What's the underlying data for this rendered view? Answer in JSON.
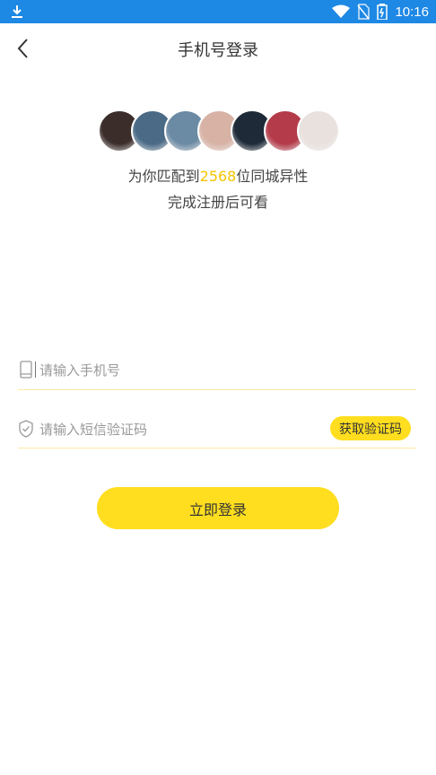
{
  "status_bar": {
    "time": "10:16"
  },
  "header": {
    "title": "手机号登录"
  },
  "match": {
    "prefix": "为你匹配到",
    "count": "2568",
    "suffix": "位同城异性",
    "subtitle": "完成注册后可看"
  },
  "avatars": [
    {
      "color": "#3a2d2a"
    },
    {
      "color": "#4a6a85"
    },
    {
      "color": "#6b8aa3"
    },
    {
      "color": "#d7b2a5"
    },
    {
      "color": "#1e2a38"
    },
    {
      "color": "#b43b4a"
    },
    {
      "color": "#e9e1de"
    }
  ],
  "form": {
    "phone_placeholder": "请输入手机号",
    "code_placeholder": "请输入短信验证码",
    "get_code_label": "获取验证码",
    "login_label": "立即登录"
  },
  "colors": {
    "accent": "#ffde1f",
    "count": "#f5c400",
    "statusbar": "#1e88e5"
  }
}
